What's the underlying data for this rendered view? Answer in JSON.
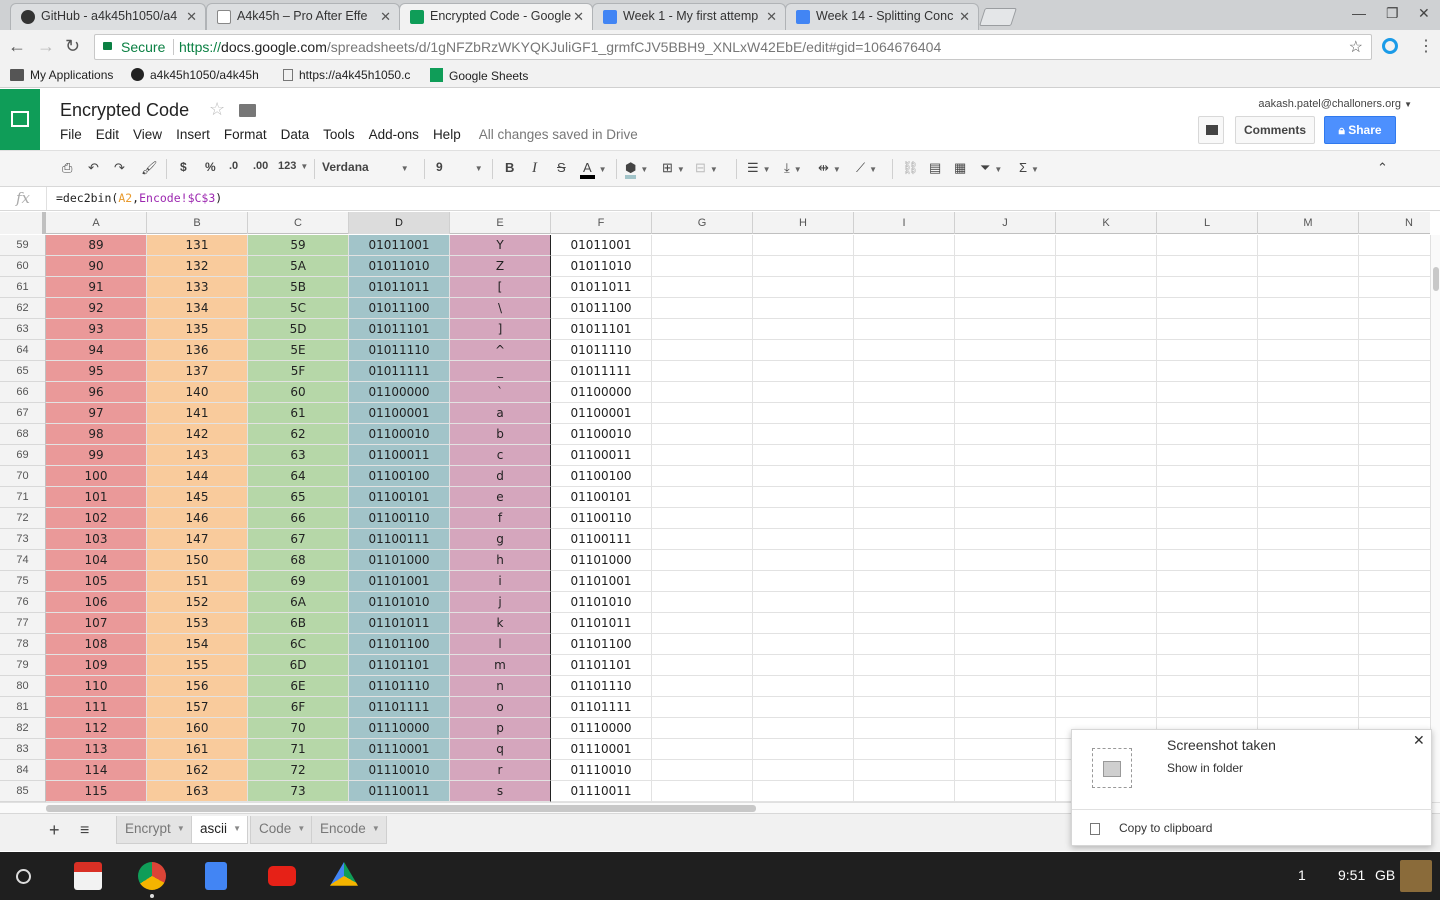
{
  "browser": {
    "tabs": [
      {
        "title": "GitHub - a4k45h1050/a4",
        "color": "#333333"
      },
      {
        "title": "A4k45h – Pro After Effe",
        "color": "#777777"
      },
      {
        "title": "Encrypted Code - Google",
        "color": "#0f9d58"
      },
      {
        "title": "Week 1 - My first attemp",
        "color": "#4285f4"
      },
      {
        "title": "Week 14 - Splitting Conc",
        "color": "#4285f4"
      }
    ],
    "url_secure": "Secure",
    "url_scheme": "https://",
    "url_host": "docs.google.com",
    "url_path": "/spreadsheets/d/1gNFZbRzWKYQKJuliGF1_grmfCJV5BBH9_XNLxW42EbE/edit#gid=1064676404",
    "bookmarks": [
      "My Applications",
      "a4k45h1050/a4k45h",
      "https://a4k45h1050.c",
      "Google Sheets"
    ]
  },
  "doc": {
    "title": "Encrypted Code",
    "menus": [
      "File",
      "Edit",
      "View",
      "Insert",
      "Format",
      "Data",
      "Tools",
      "Add-ons",
      "Help"
    ],
    "saved_status": "All changes saved in Drive",
    "account": "aakash.patel@challoners.org",
    "comments_label": "Comments",
    "share_label": "Share"
  },
  "toolbar": {
    "currency": "$",
    "percent": "%",
    "dec_less": ".0",
    "dec_more": ".00",
    "format_more": "123",
    "font": "Verdana",
    "size": "9",
    "bold": "B",
    "italic": "I",
    "strike": "S",
    "text_color": "A",
    "sum": "Σ"
  },
  "formula": {
    "fx": "fx",
    "prefix": "=dec2bin(",
    "ref1": "A2",
    "comma": ",",
    "ref2": "Encode!$C$3",
    "suffix": ")"
  },
  "columns": [
    "A",
    "B",
    "C",
    "D",
    "E",
    "F",
    "G",
    "H",
    "I",
    "J",
    "K",
    "L",
    "M",
    "N"
  ],
  "column_colors": {
    "A": "#ea9999",
    "B": "#f9cb9c",
    "C": "#b6d7a8",
    "D": "#a2c4c9",
    "E": "#d5a6bd"
  },
  "rows": [
    {
      "n": "59",
      "a": "89",
      "b": "131",
      "c": "59",
      "d": "01011001",
      "e": "Y",
      "f": "01011001"
    },
    {
      "n": "60",
      "a": "90",
      "b": "132",
      "c": "5A",
      "d": "01011010",
      "e": "Z",
      "f": "01011010"
    },
    {
      "n": "61",
      "a": "91",
      "b": "133",
      "c": "5B",
      "d": "01011011",
      "e": "[",
      "f": "01011011"
    },
    {
      "n": "62",
      "a": "92",
      "b": "134",
      "c": "5C",
      "d": "01011100",
      "e": "\\",
      "f": "01011100"
    },
    {
      "n": "63",
      "a": "93",
      "b": "135",
      "c": "5D",
      "d": "01011101",
      "e": "]",
      "f": "01011101"
    },
    {
      "n": "64",
      "a": "94",
      "b": "136",
      "c": "5E",
      "d": "01011110",
      "e": "^",
      "f": "01011110"
    },
    {
      "n": "65",
      "a": "95",
      "b": "137",
      "c": "5F",
      "d": "01011111",
      "e": "_",
      "f": "01011111"
    },
    {
      "n": "66",
      "a": "96",
      "b": "140",
      "c": "60",
      "d": "01100000",
      "e": "`",
      "f": "01100000"
    },
    {
      "n": "67",
      "a": "97",
      "b": "141",
      "c": "61",
      "d": "01100001",
      "e": "a",
      "f": "01100001"
    },
    {
      "n": "68",
      "a": "98",
      "b": "142",
      "c": "62",
      "d": "01100010",
      "e": "b",
      "f": "01100010"
    },
    {
      "n": "69",
      "a": "99",
      "b": "143",
      "c": "63",
      "d": "01100011",
      "e": "c",
      "f": "01100011"
    },
    {
      "n": "70",
      "a": "100",
      "b": "144",
      "c": "64",
      "d": "01100100",
      "e": "d",
      "f": "01100100"
    },
    {
      "n": "71",
      "a": "101",
      "b": "145",
      "c": "65",
      "d": "01100101",
      "e": "e",
      "f": "01100101"
    },
    {
      "n": "72",
      "a": "102",
      "b": "146",
      "c": "66",
      "d": "01100110",
      "e": "f",
      "f": "01100110"
    },
    {
      "n": "73",
      "a": "103",
      "b": "147",
      "c": "67",
      "d": "01100111",
      "e": "g",
      "f": "01100111"
    },
    {
      "n": "74",
      "a": "104",
      "b": "150",
      "c": "68",
      "d": "01101000",
      "e": "h",
      "f": "01101000"
    },
    {
      "n": "75",
      "a": "105",
      "b": "151",
      "c": "69",
      "d": "01101001",
      "e": "i",
      "f": "01101001"
    },
    {
      "n": "76",
      "a": "106",
      "b": "152",
      "c": "6A",
      "d": "01101010",
      "e": "j",
      "f": "01101010"
    },
    {
      "n": "77",
      "a": "107",
      "b": "153",
      "c": "6B",
      "d": "01101011",
      "e": "k",
      "f": "01101011"
    },
    {
      "n": "78",
      "a": "108",
      "b": "154",
      "c": "6C",
      "d": "01101100",
      "e": "l",
      "f": "01101100"
    },
    {
      "n": "79",
      "a": "109",
      "b": "155",
      "c": "6D",
      "d": "01101101",
      "e": "m",
      "f": "01101101"
    },
    {
      "n": "80",
      "a": "110",
      "b": "156",
      "c": "6E",
      "d": "01101110",
      "e": "n",
      "f": "01101110"
    },
    {
      "n": "81",
      "a": "111",
      "b": "157",
      "c": "6F",
      "d": "01101111",
      "e": "o",
      "f": "01101111"
    },
    {
      "n": "82",
      "a": "112",
      "b": "160",
      "c": "70",
      "d": "01110000",
      "e": "p",
      "f": "01110000"
    },
    {
      "n": "83",
      "a": "113",
      "b": "161",
      "c": "71",
      "d": "01110001",
      "e": "q",
      "f": "01110001"
    },
    {
      "n": "84",
      "a": "114",
      "b": "162",
      "c": "72",
      "d": "01110010",
      "e": "r",
      "f": "01110010"
    },
    {
      "n": "85",
      "a": "115",
      "b": "163",
      "c": "73",
      "d": "01110011",
      "e": "s",
      "f": "01110011"
    }
  ],
  "sheet_tabs": [
    "Encrypt",
    "ascii",
    "Code",
    "Encode"
  ],
  "active_sheet": "ascii",
  "toast": {
    "title": "Screenshot taken",
    "show_in_folder": "Show in folder",
    "copy": "Copy to clipboard"
  },
  "tray": {
    "notifications": "1",
    "time": "9:51",
    "locale": "GB"
  }
}
